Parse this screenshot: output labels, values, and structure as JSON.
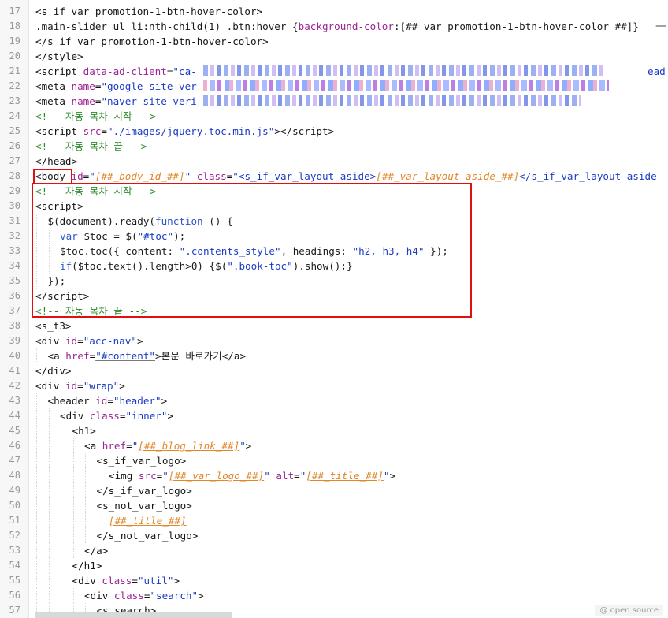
{
  "editor": {
    "lines": [
      {
        "n": "17",
        "indent": 0,
        "html": "<span class=\"tag\">&lt;s_if_var_promotion-1-btn-hover-color&gt;</span>"
      },
      {
        "n": "18",
        "indent": 0,
        "html": "<span class=\"txt\">.main-slider ul li:nth-child(1) .btn:hover {</span><span class=\"attr\">background-color</span><span class=\"txt\">:[##_var_promotion-1-btn-hover-color_##]}</span>"
      },
      {
        "n": "19",
        "indent": 0,
        "html": "<span class=\"tag\">&lt;/s_if_var_promotion-1-btn-hover-color&gt;</span>"
      },
      {
        "n": "20",
        "indent": 0,
        "html": "<span class=\"tag\">&lt;/style&gt;</span>"
      },
      {
        "n": "21",
        "indent": 0,
        "html": "<span class=\"tag\">&lt;script </span><span class=\"attr\">data-ad-client</span><span class=\"tag\">=</span><span class=\"str\">\"ca-</span>"
      },
      {
        "n": "22",
        "indent": 0,
        "html": "<span class=\"tag\">&lt;meta </span><span class=\"attr\">name</span><span class=\"tag\">=</span><span class=\"str\">\"google-site-ver</span>"
      },
      {
        "n": "23",
        "indent": 0,
        "html": "<span class=\"tag\">&lt;meta </span><span class=\"attr\">name</span><span class=\"tag\">=</span><span class=\"str\">\"naver-site-veri</span>"
      },
      {
        "n": "24",
        "indent": 0,
        "html": "<span class=\"cmt\">&lt;!-- 자동 목차 시작 --&gt;</span>"
      },
      {
        "n": "25",
        "indent": 0,
        "html": "<span class=\"tag\">&lt;script </span><span class=\"attr\">src</span><span class=\"tag\">=</span><span class=\"str underl\">\"./images/jquery.toc.min.js\"</span><span class=\"tag\">&gt;&lt;/script&gt;</span>"
      },
      {
        "n": "26",
        "indent": 0,
        "html": "<span class=\"cmt\">&lt;!-- 자동 목차 끝 --&gt;</span>"
      },
      {
        "n": "27",
        "indent": 0,
        "html": "<span class=\"tag\">&lt;/head&gt;</span>"
      },
      {
        "n": "28",
        "indent": 0,
        "html": "<span class=\"tag\">&lt;body </span><span class=\"attr\">id</span><span class=\"tag\">=</span><span class=\"str\">\"</span><span class=\"tpl\">[##_body_id_##]</span><span class=\"str\">\"</span><span class=\"tag\"> </span><span class=\"attr\">class</span><span class=\"tag\">=</span><span class=\"str\">\"&lt;s_if_var_layout-aside&gt;</span><span class=\"tpl\">[##_var_layout-aside_##]</span><span class=\"str\">&lt;/s_if_var_layout-aside</span>"
      },
      {
        "n": "29",
        "indent": 0,
        "html": "<span class=\"cmt\">&lt;!-- 자동 목차 시작 --&gt;</span>"
      },
      {
        "n": "30",
        "indent": 0,
        "html": "<span class=\"tag\">&lt;script&gt;</span>"
      },
      {
        "n": "31",
        "indent": 1,
        "html": "<span class=\"txt\">$(document).ready(</span><span class=\"kw\">function</span><span class=\"txt\"> () {</span>"
      },
      {
        "n": "32",
        "indent": 2,
        "html": "<span class=\"kw\">var</span><span class=\"txt\"> $toc = $(</span><span class=\"str\">\"#toc\"</span><span class=\"txt\">);</span>"
      },
      {
        "n": "33",
        "indent": 2,
        "html": "<span class=\"txt\">$toc.toc({ content: </span><span class=\"str\">\".contents_style\"</span><span class=\"txt\">, headings: </span><span class=\"str\">\"h2, h3, h4\"</span><span class=\"txt\"> });</span>"
      },
      {
        "n": "34",
        "indent": 2,
        "html": "<span class=\"kw\">if</span><span class=\"txt\">($toc.text().length&gt;0) {$(</span><span class=\"str\">\".book-toc\"</span><span class=\"txt\">).show();}</span>"
      },
      {
        "n": "35",
        "indent": 1,
        "html": "<span class=\"txt\">});</span>"
      },
      {
        "n": "36",
        "indent": 0,
        "html": "<span class=\"tag\">&lt;/script&gt;</span>"
      },
      {
        "n": "37",
        "indent": 0,
        "html": "<span class=\"cmt\">&lt;!-- 자동 목차 끝 --&gt;</span>"
      },
      {
        "n": "38",
        "indent": 0,
        "html": "<span class=\"tag\">&lt;s_t3&gt;</span>"
      },
      {
        "n": "39",
        "indent": 0,
        "html": "<span class=\"tag\">&lt;div </span><span class=\"attr\">id</span><span class=\"tag\">=</span><span class=\"str\">\"acc-nav\"</span><span class=\"tag\">&gt;</span>"
      },
      {
        "n": "40",
        "indent": 1,
        "html": "<span class=\"tag\">&lt;a </span><span class=\"attr\">href</span><span class=\"tag\">=</span><span class=\"str underl\">\"#content\"</span><span class=\"tag\">&gt;</span><span class=\"txt\">본문 바로가기</span><span class=\"tag\">&lt;/a&gt;</span>"
      },
      {
        "n": "41",
        "indent": 0,
        "html": "<span class=\"tag\">&lt;/div&gt;</span>"
      },
      {
        "n": "42",
        "indent": 0,
        "html": "<span class=\"tag\">&lt;div </span><span class=\"attr\">id</span><span class=\"tag\">=</span><span class=\"str\">\"wrap\"</span><span class=\"tag\">&gt;</span>"
      },
      {
        "n": "43",
        "indent": 1,
        "html": "<span class=\"tag\">&lt;header </span><span class=\"attr\">id</span><span class=\"tag\">=</span><span class=\"str\">\"header\"</span><span class=\"tag\">&gt;</span>"
      },
      {
        "n": "44",
        "indent": 2,
        "html": "<span class=\"tag\">&lt;div </span><span class=\"attr\">class</span><span class=\"tag\">=</span><span class=\"str\">\"inner\"</span><span class=\"tag\">&gt;</span>"
      },
      {
        "n": "45",
        "indent": 3,
        "html": "<span class=\"tag\">&lt;h1&gt;</span>"
      },
      {
        "n": "46",
        "indent": 4,
        "html": "<span class=\"tag\">&lt;a </span><span class=\"attr\">href</span><span class=\"tag\">=</span><span class=\"str\">\"</span><span class=\"tpl\">[##_blog_link_##]</span><span class=\"str\">\"</span><span class=\"tag\">&gt;</span>"
      },
      {
        "n": "47",
        "indent": 5,
        "html": "<span class=\"tag\">&lt;s_if_var_logo&gt;</span>"
      },
      {
        "n": "48",
        "indent": 6,
        "html": "<span class=\"tag\">&lt;img </span><span class=\"attr\">src</span><span class=\"tag\">=</span><span class=\"str\">\"</span><span class=\"tpl\">[##_var_logo_##]</span><span class=\"str\">\"</span><span class=\"tag\"> </span><span class=\"attr\">alt</span><span class=\"tag\">=</span><span class=\"str\">\"</span><span class=\"tpl\">[##_title_##]</span><span class=\"str\">\"</span><span class=\"tag\">&gt;</span>"
      },
      {
        "n": "49",
        "indent": 5,
        "html": "<span class=\"tag\">&lt;/s_if_var_logo&gt;</span>"
      },
      {
        "n": "50",
        "indent": 5,
        "html": "<span class=\"tag\">&lt;s_not_var_logo&gt;</span>"
      },
      {
        "n": "51",
        "indent": 6,
        "html": "<span class=\"tpl\">[##_title_##]</span>"
      },
      {
        "n": "52",
        "indent": 5,
        "html": "<span class=\"tag\">&lt;/s_not_var_logo&gt;</span>"
      },
      {
        "n": "53",
        "indent": 4,
        "html": "<span class=\"tag\">&lt;/a&gt;</span>"
      },
      {
        "n": "54",
        "indent": 3,
        "html": "<span class=\"tag\">&lt;/h1&gt;</span>"
      },
      {
        "n": "55",
        "indent": 3,
        "html": "<span class=\"tag\">&lt;div </span><span class=\"attr\">class</span><span class=\"tag\">=</span><span class=\"str\">\"util\"</span><span class=\"tag\">&gt;</span>"
      },
      {
        "n": "56",
        "indent": 4,
        "html": "<span class=\"tag\">&lt;div </span><span class=\"attr\">class</span><span class=\"tag\">=</span><span class=\"str\">\"search\"</span><span class=\"tag\">&gt;</span>"
      },
      {
        "n": "57",
        "indent": 5,
        "html": "<span class=\"tag\">&lt;s_search&gt;</span>"
      }
    ],
    "line28_tail": "ead",
    "scroll_top_glyph": "—",
    "footer_label": "@ open source"
  }
}
